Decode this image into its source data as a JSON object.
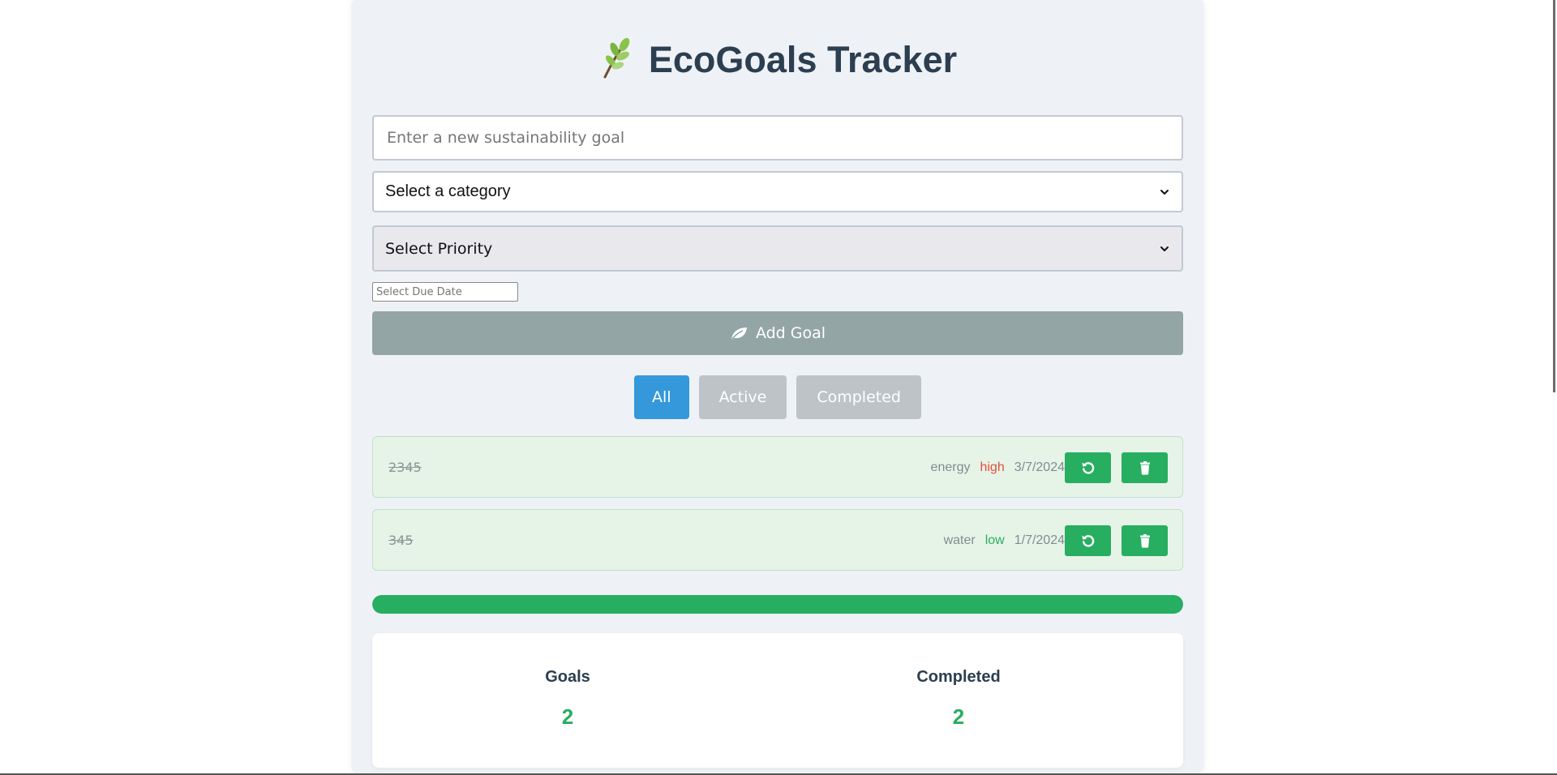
{
  "app": {
    "title": "EcoGoals Tracker",
    "logo_icon": "seedling-icon"
  },
  "form": {
    "goal_placeholder": "Enter a new sustainability goal",
    "goal_value": "",
    "category_selected": "Select a category",
    "priority_selected": "Select Priority",
    "due_date_placeholder": "Select Due Date",
    "due_date_value": "",
    "add_button_label": "Add Goal",
    "add_button_icon": "leaf-icon"
  },
  "filters": [
    {
      "label": "All",
      "active": true
    },
    {
      "label": "Active",
      "active": false
    },
    {
      "label": "Completed",
      "active": false
    }
  ],
  "goals": [
    {
      "text": "2345",
      "category": "energy",
      "priority": "high",
      "due": "3/7/2024",
      "completed": true,
      "undo_icon": "undo-icon",
      "delete_icon": "trash-icon"
    },
    {
      "text": "345",
      "category": "water",
      "priority": "low",
      "due": "1/7/2024",
      "completed": true,
      "undo_icon": "undo-icon",
      "delete_icon": "trash-icon"
    }
  ],
  "progress": {
    "fraction": 1.0
  },
  "stats": {
    "goals_label": "Goals",
    "goals_value": "2",
    "completed_label": "Completed",
    "completed_value": "2"
  },
  "colors": {
    "primary_text": "#2c3e50",
    "accent_blue": "#3498db",
    "accent_green": "#27ae60",
    "priority_high": "#e74c3c",
    "priority_low": "#27ae60",
    "button_muted": "#bdc3c7",
    "add_button_bg": "#93a5a5",
    "goal_completed_bg": "#e6f4e8",
    "container_bg": "#eef2f7"
  }
}
